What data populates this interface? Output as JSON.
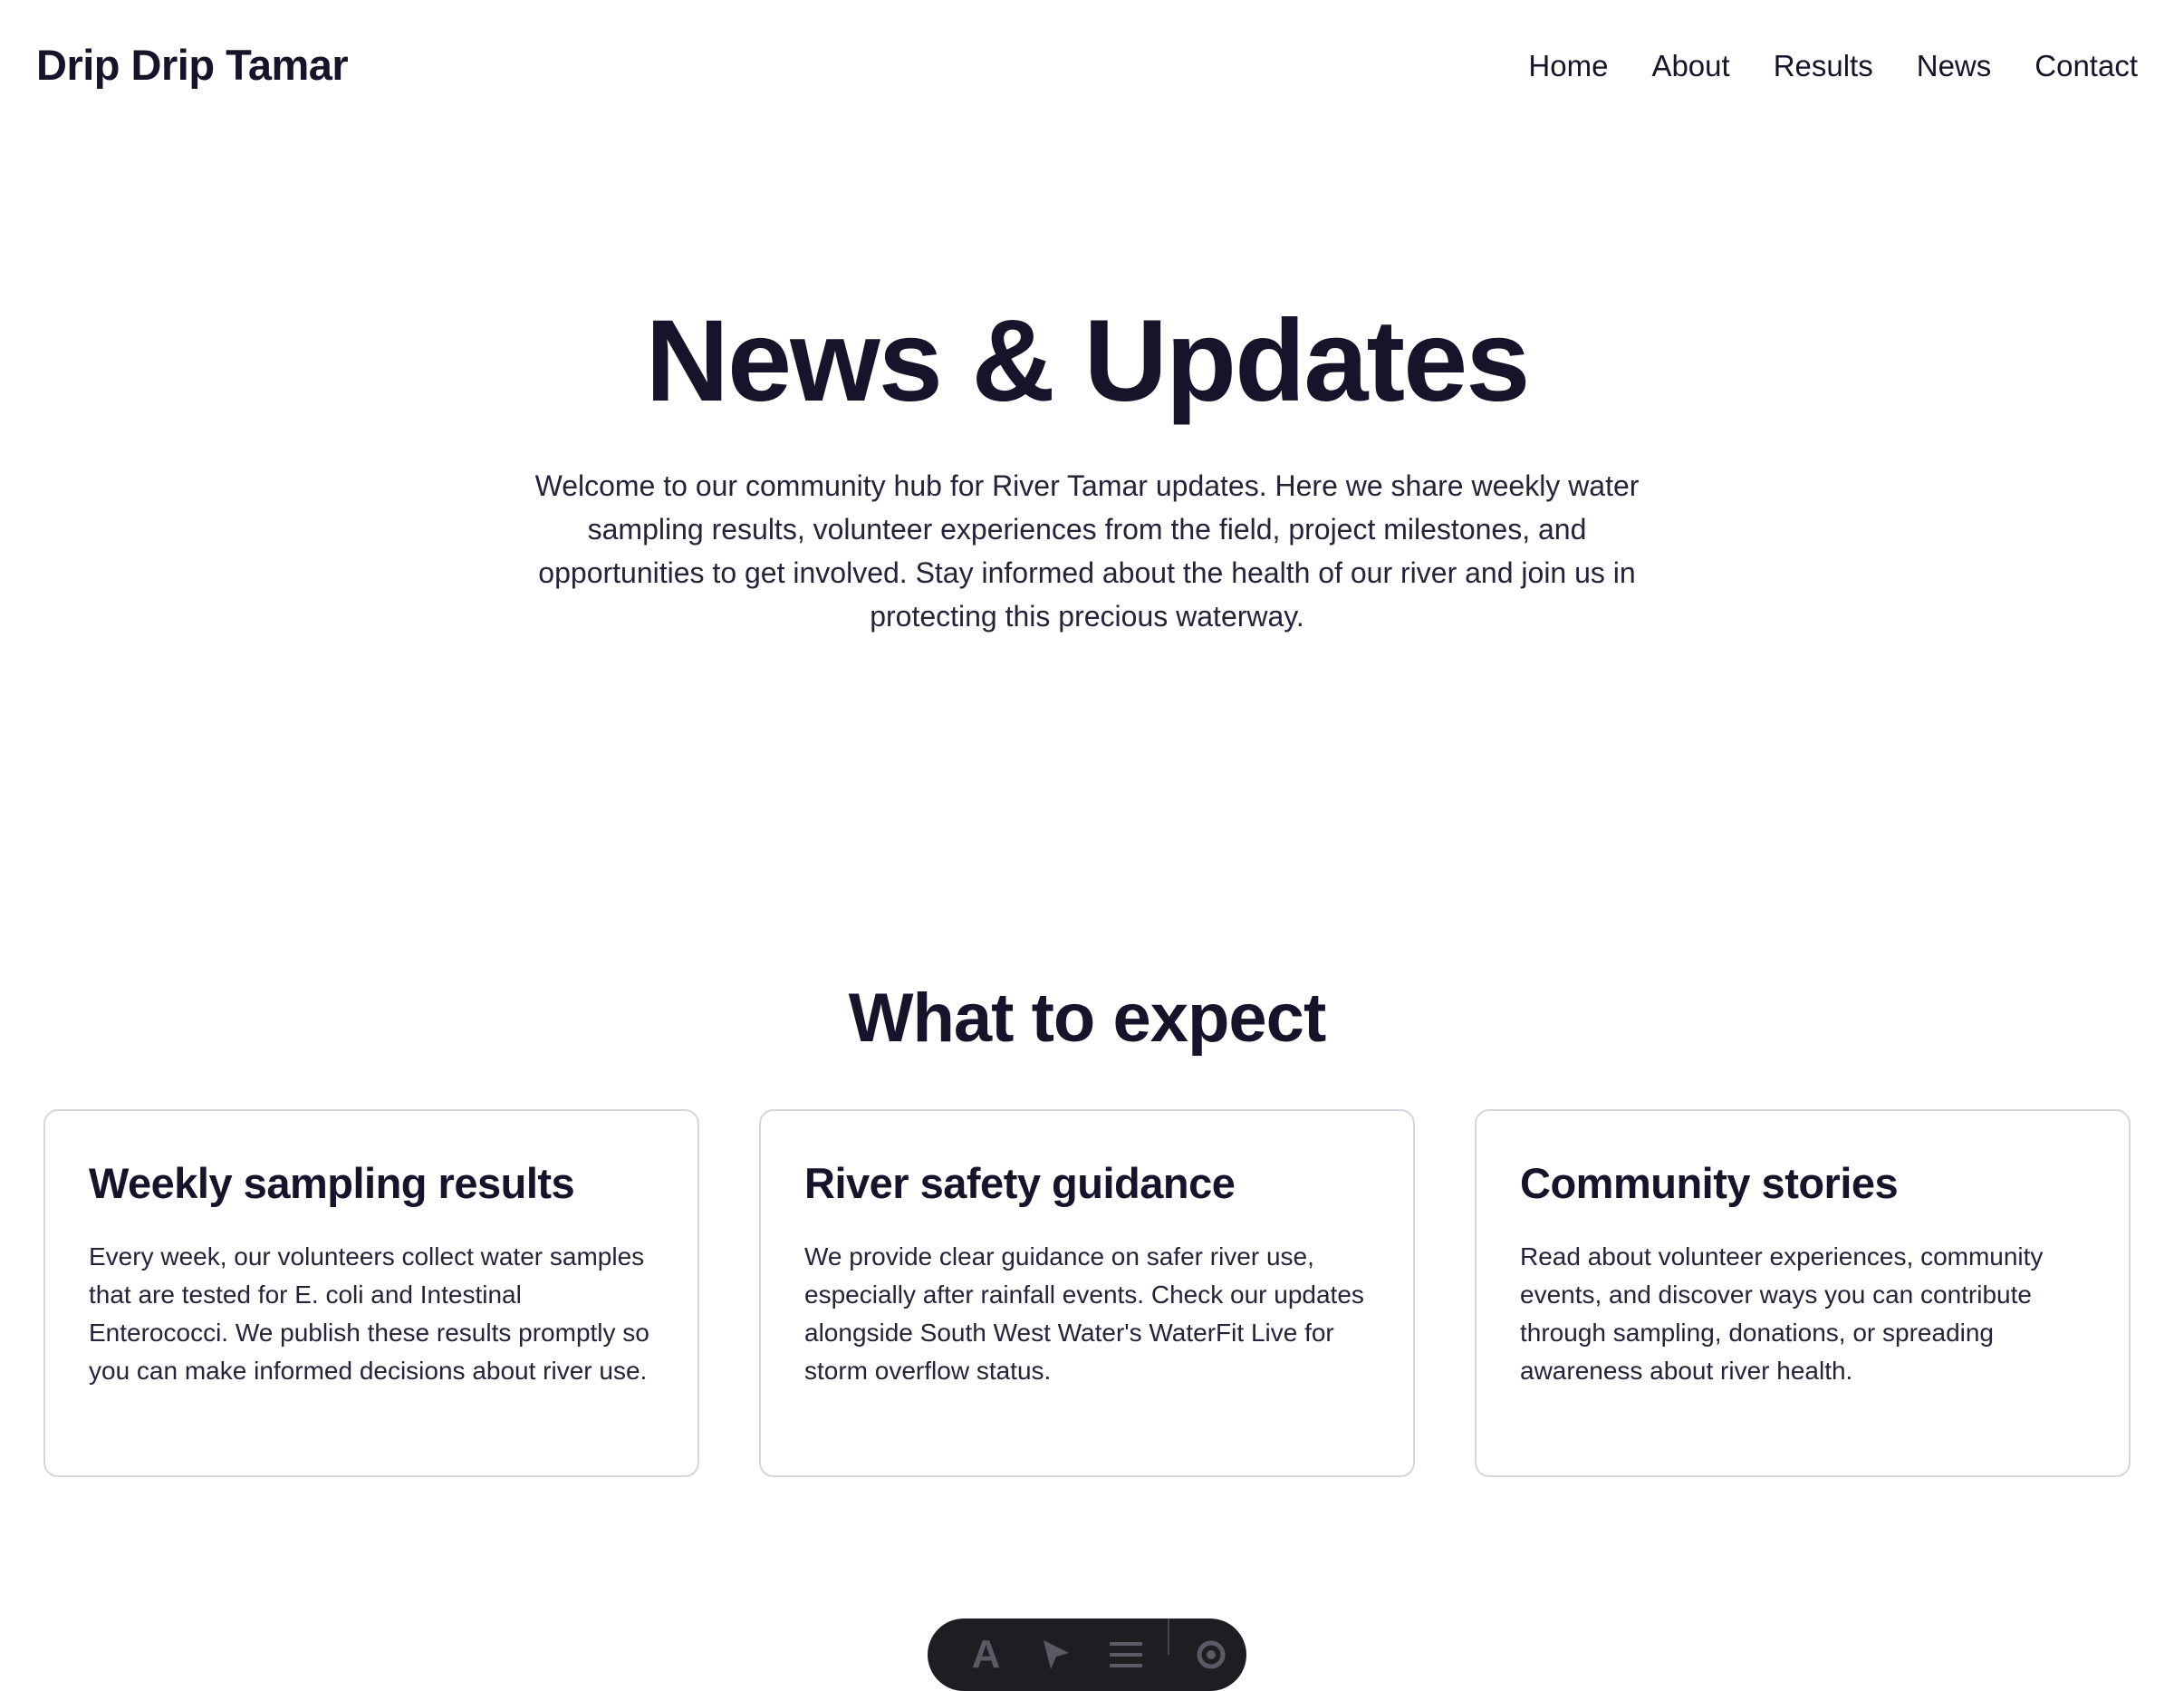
{
  "header": {
    "brand": "Drip Drip Tamar",
    "nav": [
      {
        "label": "Home"
      },
      {
        "label": "About"
      },
      {
        "label": "Results"
      },
      {
        "label": "News"
      },
      {
        "label": "Contact"
      }
    ]
  },
  "hero": {
    "title": "News & Updates",
    "intro": "Welcome to our community hub for River Tamar updates. Here we share weekly water sampling results, volunteer experiences from the field, project milestones, and opportunities to get involved. Stay informed about the health of our river and join us in protecting this precious waterway."
  },
  "expect": {
    "heading": "What to expect",
    "cards": [
      {
        "title": "Weekly sampling results",
        "body": "Every week, our volunteers collect water samples that are tested for E. coli and Intestinal Enterococci. We publish these results promptly so you can make informed decisions about river use."
      },
      {
        "title": "River safety guidance",
        "body": "We provide clear guidance on safer river use, especially after rainfall events. Check our updates alongside South West Water's WaterFit Live for storm overflow status."
      },
      {
        "title": "Community stories",
        "body": "Read about volunteer experiences, community events, and discover ways you can contribute through sampling, donations, or spreading awareness about river health."
      }
    ]
  },
  "toolbar": {
    "icons": [
      "text-icon",
      "pointer-icon",
      "menu-icon",
      "settings-icon"
    ],
    "text_glyph": "A"
  }
}
